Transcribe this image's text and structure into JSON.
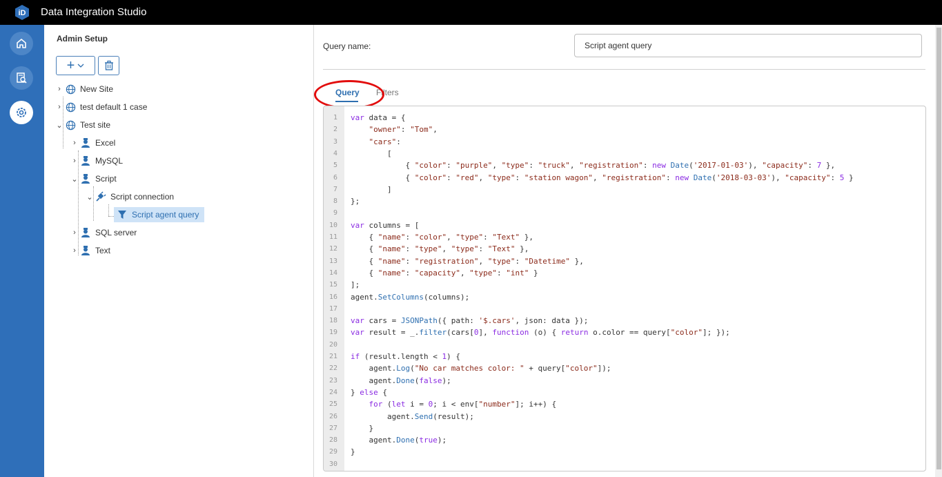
{
  "app": {
    "title": "Data Integration Studio"
  },
  "rail": {
    "items": [
      {
        "icon": "home-icon"
      },
      {
        "icon": "report-search-icon"
      },
      {
        "icon": "settings-gear-icon",
        "active": true
      }
    ]
  },
  "panel": {
    "title": "Admin Setup"
  },
  "tree": [
    {
      "label": "New Site",
      "icon": "globe-icon"
    },
    {
      "label": "test default 1 case",
      "icon": "globe-icon"
    },
    {
      "label": "Test site",
      "icon": "globe-icon"
    },
    {
      "label": "Excel",
      "icon": "agent-icon"
    },
    {
      "label": "MySQL",
      "icon": "agent-icon"
    },
    {
      "label": "Script",
      "icon": "agent-icon"
    },
    {
      "label": "Script connection",
      "icon": "plug-icon"
    },
    {
      "label": "Script agent query",
      "icon": "filter-icon",
      "selected": true
    },
    {
      "label": "SQL server",
      "icon": "agent-icon"
    },
    {
      "label": "Text",
      "icon": "agent-icon"
    }
  ],
  "form": {
    "query_name_label": "Query name:",
    "query_name_value": "Script agent query"
  },
  "tabs": [
    {
      "label": "Query",
      "active": true
    },
    {
      "label": "Filters"
    }
  ],
  "colors": {
    "accent": "#2e6fb0",
    "rail": "#2f6fb9",
    "topbar": "#000000",
    "annotation": "#e20d0d",
    "keyword": "#8a2be2",
    "string": "#8b2a1a"
  },
  "code": {
    "lines": [
      "var data = {",
      "    \"owner\": \"Tom\",",
      "    \"cars\":",
      "        [",
      "            { \"color\": \"purple\", \"type\": \"truck\", \"registration\": new Date('2017-01-03'), \"capacity\": 7 },",
      "            { \"color\": \"red\", \"type\": \"station wagon\", \"registration\": new Date('2018-03-03'), \"capacity\": 5 }",
      "        ]",
      "};",
      "",
      "var columns = [",
      "    { \"name\": \"color\", \"type\": \"Text\" },",
      "    { \"name\": \"type\", \"type\": \"Text\" },",
      "    { \"name\": \"registration\", \"type\": \"Datetime\" },",
      "    { \"name\": \"capacity\", \"type\": \"int\" }",
      "];",
      "agent.SetColumns(columns);",
      "",
      "var cars = JSONPath({ path: '$.cars', json: data });",
      "var result = _.filter(cars[0], function (o) { return o.color == query[\"color\"]; });",
      "",
      "if (result.length < 1) {",
      "    agent.Log(\"No car matches color: \" + query[\"color\"]);",
      "    agent.Done(false);",
      "} else {",
      "    for (let i = 0; i < env[\"number\"]; i++) {",
      "        agent.Send(result);",
      "    }",
      "    agent.Done(true);",
      "}",
      ""
    ]
  }
}
